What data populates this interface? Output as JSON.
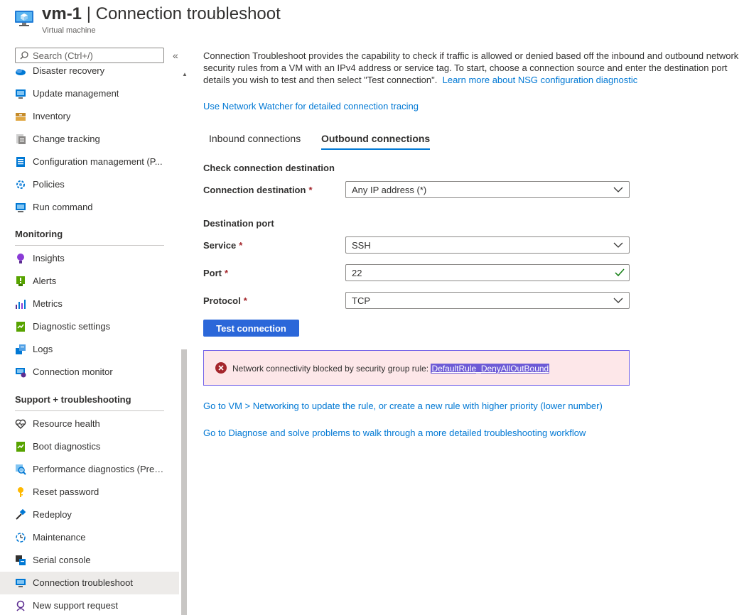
{
  "header": {
    "resource_name": "vm-1",
    "separator": " | ",
    "page_title": "Connection troubleshoot",
    "subtitle": "Virtual machine"
  },
  "sidebar": {
    "search_placeholder": "Search (Ctrl+/)",
    "collapse_glyph": "«",
    "scroll_up_glyph": "▲",
    "items_top": [
      {
        "label": "Disaster recovery",
        "icon": "disaster-recovery-icon"
      },
      {
        "label": "Update management",
        "icon": "update-management-icon"
      },
      {
        "label": "Inventory",
        "icon": "inventory-icon"
      },
      {
        "label": "Change tracking",
        "icon": "change-tracking-icon"
      },
      {
        "label": "Configuration management (P...",
        "icon": "configuration-management-icon"
      },
      {
        "label": "Policies",
        "icon": "policies-icon"
      },
      {
        "label": "Run command",
        "icon": "run-command-icon"
      }
    ],
    "monitoring_header": "Monitoring",
    "monitoring_items": [
      {
        "label": "Insights",
        "icon": "insights-icon"
      },
      {
        "label": "Alerts",
        "icon": "alerts-icon"
      },
      {
        "label": "Metrics",
        "icon": "metrics-icon"
      },
      {
        "label": "Diagnostic settings",
        "icon": "diagnostic-settings-icon"
      },
      {
        "label": "Logs",
        "icon": "logs-icon"
      },
      {
        "label": "Connection monitor",
        "icon": "connection-monitor-icon"
      }
    ],
    "support_header": "Support + troubleshooting",
    "support_items": [
      {
        "label": "Resource health",
        "icon": "resource-health-icon"
      },
      {
        "label": "Boot diagnostics",
        "icon": "boot-diagnostics-icon"
      },
      {
        "label": "Performance diagnostics (Prev...",
        "icon": "performance-diagnostics-icon"
      },
      {
        "label": "Reset password",
        "icon": "reset-password-icon"
      },
      {
        "label": "Redeploy",
        "icon": "redeploy-icon"
      },
      {
        "label": "Maintenance",
        "icon": "maintenance-icon"
      },
      {
        "label": "Serial console",
        "icon": "serial-console-icon"
      },
      {
        "label": "Connection troubleshoot",
        "icon": "connection-troubleshoot-icon",
        "active": true
      },
      {
        "label": "New support request",
        "icon": "new-support-request-icon"
      }
    ]
  },
  "main": {
    "intro_text": "Connection Troubleshoot provides the capability to check if traffic is allowed or denied based off the inbound and outbound network security rules from a VM with an IPv4 address or service tag. To start, choose a connection source and enter the destination port details you wish to test and then select \"Test connection\".",
    "intro_link": "Learn more about NSG configuration diagnostic",
    "watcher_link": "Use Network Watcher for detailed connection tracing",
    "tabs": [
      {
        "label": "Inbound connections",
        "selected": false
      },
      {
        "label": "Outbound connections",
        "selected": true
      }
    ],
    "check_header": "Check connection destination",
    "connection_destination": {
      "label": "Connection destination",
      "value": "Any IP address (*)"
    },
    "port_header": "Destination port",
    "service": {
      "label": "Service",
      "value": "SSH"
    },
    "port": {
      "label": "Port",
      "value": "22"
    },
    "protocol": {
      "label": "Protocol",
      "value": "TCP"
    },
    "required_mark": "*",
    "test_button": "Test connection",
    "error": {
      "message": "Network connectivity blocked by security group rule:",
      "rule": "DefaultRule_DenyAllOutBound"
    },
    "goto_rule_link": "Go to VM > Networking to update the rule, or create a new rule with higher priority (lower number)",
    "goto_diagnose_link": "Go to Diagnose and solve problems to walk through a more detailed troubleshooting workflow"
  },
  "colors": {
    "accent": "#0078d4",
    "button": "#2b67d9",
    "error_bg": "#fde7e9",
    "error_icon": "#a4262c",
    "required": "#a4262c",
    "valid_check": "#107c10"
  }
}
